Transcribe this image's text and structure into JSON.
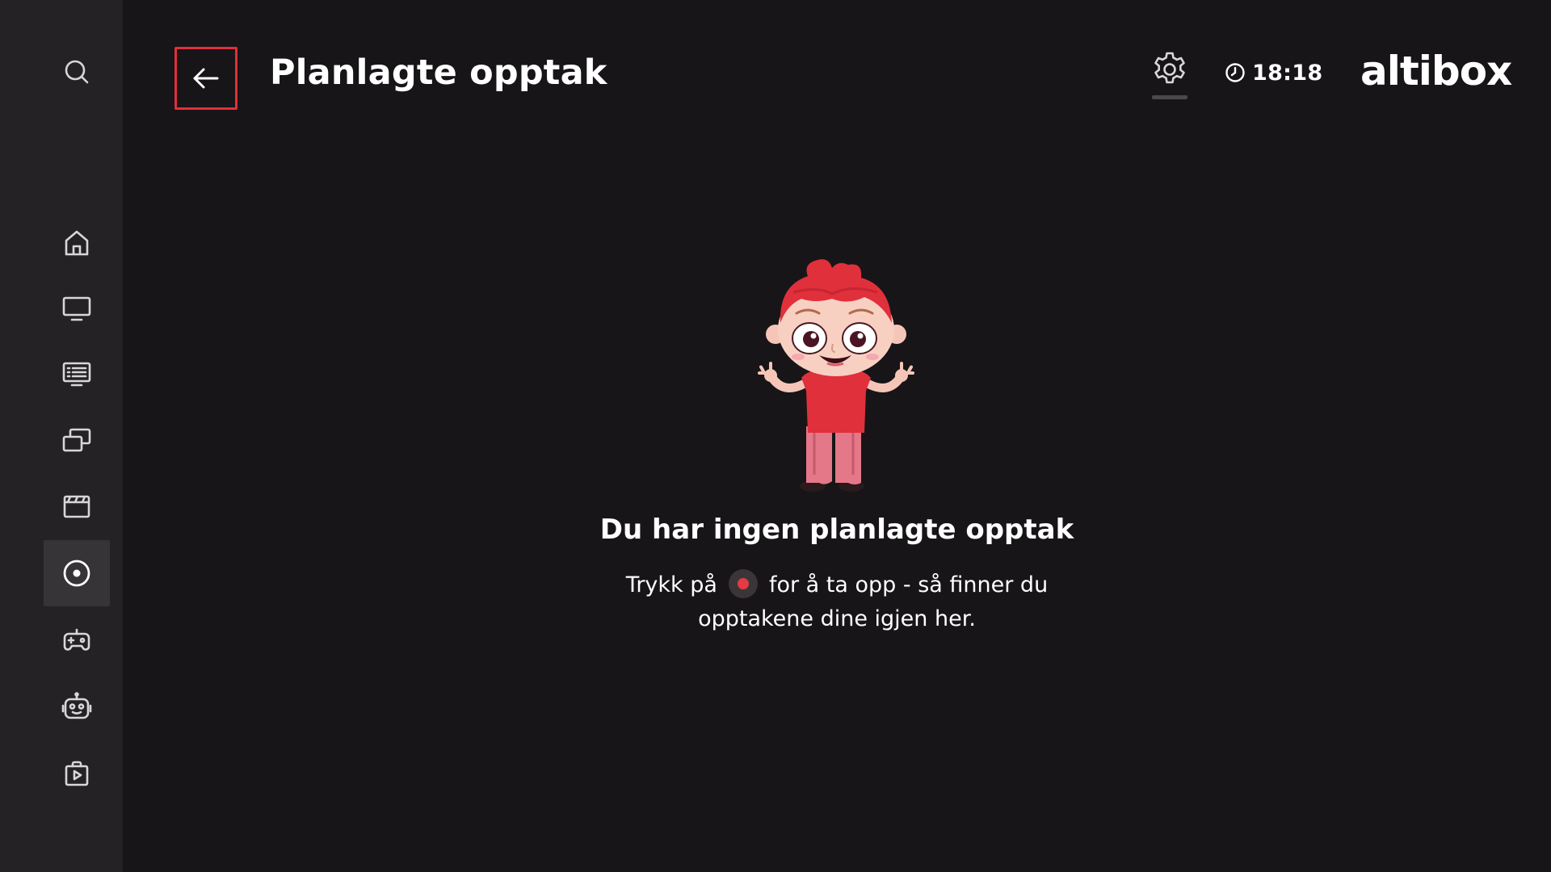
{
  "header": {
    "title": "Planlagte opptak",
    "time": "18:18",
    "logo": "altibox"
  },
  "sidebar": {
    "items": [
      {
        "icon": "search-icon",
        "active": false
      },
      {
        "icon": "home-icon",
        "active": false
      },
      {
        "icon": "tv-icon",
        "active": false
      },
      {
        "icon": "tv-guide-icon",
        "active": false
      },
      {
        "icon": "catchup-icon",
        "active": false
      },
      {
        "icon": "movies-icon",
        "active": false
      },
      {
        "icon": "recordings-icon",
        "active": true
      },
      {
        "icon": "games-icon",
        "active": false
      },
      {
        "icon": "kids-icon",
        "active": false
      },
      {
        "icon": "store-icon",
        "active": false
      }
    ]
  },
  "empty_state": {
    "title": "Du har ingen planlagte opptak",
    "desc_before": "Trykk på",
    "desc_after": "for å ta opp - så finner du opptakene dine igjen her."
  },
  "colors": {
    "background": "#171517",
    "sidebar": "#242224",
    "accent": "#e0303b"
  }
}
